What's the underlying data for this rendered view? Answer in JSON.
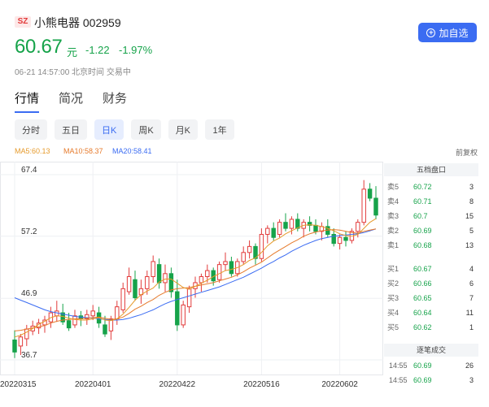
{
  "header": {
    "exchange": "SZ",
    "stock_name": "小熊电器 002959",
    "price": "60.67",
    "unit": "元",
    "change": "-1.22",
    "change_pct": "-1.97%",
    "time_status": "06-21 14:57:00 北京时间 交易中",
    "add_button": "加自选"
  },
  "tabs": [
    "行情",
    "简况",
    "财务"
  ],
  "periods": [
    "分时",
    "五日",
    "日K",
    "周K",
    "月K",
    "1年"
  ],
  "ma": {
    "ma5": "MA5:60.13",
    "ma10": "MA10:58.37",
    "ma20": "MA20:58.41",
    "adjust": "前复权"
  },
  "order_book": {
    "title": "五档盘口",
    "sell": [
      {
        "label": "卖5",
        "price": "60.72",
        "vol": "3"
      },
      {
        "label": "卖4",
        "price": "60.71",
        "vol": "8"
      },
      {
        "label": "卖3",
        "price": "60.7",
        "vol": "15"
      },
      {
        "label": "卖2",
        "price": "60.69",
        "vol": "5"
      },
      {
        "label": "卖1",
        "price": "60.68",
        "vol": "13"
      }
    ],
    "buy": [
      {
        "label": "买1",
        "price": "60.67",
        "vol": "4"
      },
      {
        "label": "买2",
        "price": "60.66",
        "vol": "6"
      },
      {
        "label": "买3",
        "price": "60.65",
        "vol": "7"
      },
      {
        "label": "买4",
        "price": "60.64",
        "vol": "11"
      },
      {
        "label": "买5",
        "price": "60.62",
        "vol": "1"
      }
    ],
    "trades_title": "逐笔成交",
    "trades": [
      {
        "time": "14:55",
        "price": "60.69",
        "vol": "26"
      },
      {
        "time": "14:55",
        "price": "60.69",
        "vol": "3"
      }
    ]
  },
  "colors": {
    "up": "#e23b3b",
    "down": "#16a34a",
    "accent": "#3b6cf2",
    "ma5": "#e69a2b",
    "ma10": "#e67a2b",
    "ma20": "#3b6cf2"
  },
  "chart_data": {
    "type": "candlestick",
    "y_ticks": [
      "67.4",
      "57.2",
      "46.9",
      "36.7"
    ],
    "ylim": [
      36.7,
      67.4
    ],
    "x_ticks": [
      {
        "label": "20220315",
        "index": 0
      },
      {
        "label": "20220401",
        "index": 13
      },
      {
        "label": "20220422",
        "index": 27
      },
      {
        "label": "20220516",
        "index": 41
      },
      {
        "label": "20220602",
        "index": 54
      }
    ],
    "candles": [
      {
        "o": 40.0,
        "h": 41.6,
        "l": 37.0,
        "c": 38.0
      },
      {
        "o": 39.0,
        "h": 41.0,
        "l": 37.5,
        "c": 40.5
      },
      {
        "o": 40.2,
        "h": 42.5,
        "l": 39.0,
        "c": 41.8
      },
      {
        "o": 41.5,
        "h": 43.2,
        "l": 40.8,
        "c": 42.3
      },
      {
        "o": 42.0,
        "h": 43.5,
        "l": 41.0,
        "c": 42.8
      },
      {
        "o": 42.5,
        "h": 44.0,
        "l": 41.2,
        "c": 43.3
      },
      {
        "o": 43.0,
        "h": 45.5,
        "l": 42.0,
        "c": 44.5
      },
      {
        "o": 44.0,
        "h": 46.5,
        "l": 43.0,
        "c": 44.8
      },
      {
        "o": 44.5,
        "h": 46.0,
        "l": 42.5,
        "c": 43.0
      },
      {
        "o": 43.2,
        "h": 44.5,
        "l": 41.5,
        "c": 42.0
      },
      {
        "o": 42.5,
        "h": 45.0,
        "l": 42.0,
        "c": 44.0
      },
      {
        "o": 44.0,
        "h": 44.8,
        "l": 42.3,
        "c": 43.5
      },
      {
        "o": 43.5,
        "h": 45.0,
        "l": 42.5,
        "c": 44.2
      },
      {
        "o": 44.0,
        "h": 45.8,
        "l": 43.3,
        "c": 44.8
      },
      {
        "o": 44.5,
        "h": 45.5,
        "l": 42.0,
        "c": 42.8
      },
      {
        "o": 42.5,
        "h": 44.0,
        "l": 40.5,
        "c": 41.0
      },
      {
        "o": 41.5,
        "h": 44.0,
        "l": 40.0,
        "c": 43.5
      },
      {
        "o": 43.5,
        "h": 46.5,
        "l": 42.5,
        "c": 45.5
      },
      {
        "o": 45.0,
        "h": 49.5,
        "l": 44.5,
        "c": 48.5
      },
      {
        "o": 48.0,
        "h": 52.0,
        "l": 47.5,
        "c": 50.5
      },
      {
        "o": 50.0,
        "h": 51.5,
        "l": 46.5,
        "c": 47.0
      },
      {
        "o": 47.5,
        "h": 50.0,
        "l": 46.0,
        "c": 48.5
      },
      {
        "o": 48.5,
        "h": 51.5,
        "l": 47.5,
        "c": 50.5
      },
      {
        "o": 50.5,
        "h": 54.0,
        "l": 49.5,
        "c": 53.0
      },
      {
        "o": 52.5,
        "h": 53.5,
        "l": 48.5,
        "c": 49.5
      },
      {
        "o": 49.5,
        "h": 52.5,
        "l": 48.0,
        "c": 51.0
      },
      {
        "o": 51.0,
        "h": 52.0,
        "l": 47.0,
        "c": 48.0
      },
      {
        "o": 48.0,
        "h": 50.0,
        "l": 41.5,
        "c": 42.5
      },
      {
        "o": 42.5,
        "h": 46.5,
        "l": 42.0,
        "c": 45.8
      },
      {
        "o": 45.5,
        "h": 49.0,
        "l": 44.5,
        "c": 48.5
      },
      {
        "o": 48.5,
        "h": 50.5,
        "l": 47.0,
        "c": 49.5
      },
      {
        "o": 49.5,
        "h": 51.0,
        "l": 48.0,
        "c": 50.5
      },
      {
        "o": 50.5,
        "h": 52.5,
        "l": 49.5,
        "c": 51.5
      },
      {
        "o": 51.5,
        "h": 52.0,
        "l": 49.0,
        "c": 49.8
      },
      {
        "o": 50.0,
        "h": 53.0,
        "l": 49.5,
        "c": 52.5
      },
      {
        "o": 52.5,
        "h": 54.5,
        "l": 51.5,
        "c": 53.0
      },
      {
        "o": 53.0,
        "h": 53.8,
        "l": 50.5,
        "c": 51.0
      },
      {
        "o": 51.0,
        "h": 53.5,
        "l": 50.5,
        "c": 53.0
      },
      {
        "o": 53.0,
        "h": 55.5,
        "l": 52.5,
        "c": 54.5
      },
      {
        "o": 54.5,
        "h": 56.5,
        "l": 53.5,
        "c": 55.5
      },
      {
        "o": 55.5,
        "h": 56.0,
        "l": 52.5,
        "c": 53.5
      },
      {
        "o": 53.5,
        "h": 58.5,
        "l": 53.0,
        "c": 57.5
      },
      {
        "o": 57.5,
        "h": 59.0,
        "l": 56.0,
        "c": 58.5
      },
      {
        "o": 58.5,
        "h": 59.5,
        "l": 56.5,
        "c": 57.0
      },
      {
        "o": 57.5,
        "h": 60.0,
        "l": 57.0,
        "c": 59.5
      },
      {
        "o": 59.5,
        "h": 61.0,
        "l": 58.0,
        "c": 58.5
      },
      {
        "o": 58.5,
        "h": 60.5,
        "l": 57.5,
        "c": 60.0
      },
      {
        "o": 60.0,
        "h": 61.0,
        "l": 58.0,
        "c": 58.5
      },
      {
        "o": 58.5,
        "h": 60.0,
        "l": 57.0,
        "c": 59.5
      },
      {
        "o": 59.5,
        "h": 60.5,
        "l": 58.0,
        "c": 59.0
      },
      {
        "o": 59.0,
        "h": 60.0,
        "l": 57.5,
        "c": 58.0
      },
      {
        "o": 58.0,
        "h": 59.5,
        "l": 56.5,
        "c": 58.8
      },
      {
        "o": 58.8,
        "h": 60.0,
        "l": 57.0,
        "c": 57.5
      },
      {
        "o": 57.5,
        "h": 58.5,
        "l": 55.5,
        "c": 56.0
      },
      {
        "o": 56.0,
        "h": 57.5,
        "l": 55.0,
        "c": 57.0
      },
      {
        "o": 57.0,
        "h": 58.0,
        "l": 55.5,
        "c": 56.5
      },
      {
        "o": 56.5,
        "h": 58.5,
        "l": 56.0,
        "c": 58.0
      },
      {
        "o": 58.0,
        "h": 60.0,
        "l": 57.0,
        "c": 59.5
      },
      {
        "o": 59.5,
        "h": 66.5,
        "l": 59.0,
        "c": 65.0
      },
      {
        "o": 65.0,
        "h": 66.0,
        "l": 63.0,
        "c": 63.5
      },
      {
        "o": 63.5,
        "h": 65.5,
        "l": 60.0,
        "c": 60.7
      }
    ],
    "ma5": [
      40.5,
      40.8,
      41.3,
      41.9,
      42.6,
      43.1,
      43.7,
      44.0,
      43.9,
      43.6,
      43.4,
      43.3,
      43.3,
      43.5,
      43.7,
      43.3,
      43.2,
      43.5,
      44.3,
      45.4,
      46.6,
      47.5,
      48.1,
      48.6,
      49.6,
      50.1,
      50.1,
      49.4,
      48.7,
      48.4,
      48.9,
      49.4,
      49.9,
      50.5,
      51.0,
      51.5,
      51.7,
      52.0,
      52.5,
      53.2,
      53.6,
      54.5,
      55.6,
      56.4,
      56.9,
      57.6,
      58.1,
      58.6,
      59.0,
      59.1,
      59.0,
      58.8,
      58.5,
      58.1,
      57.6,
      57.3,
      57.2,
      57.5,
      58.5,
      59.5,
      60.1
    ],
    "ma10": [
      41.5,
      41.6,
      41.8,
      42.0,
      42.2,
      42.4,
      42.8,
      43.1,
      43.3,
      43.4,
      43.5,
      43.5,
      43.6,
      43.7,
      43.8,
      43.6,
      43.4,
      43.5,
      43.8,
      44.4,
      45.1,
      45.6,
      46.2,
      46.7,
      47.4,
      47.9,
      48.3,
      48.5,
      48.6,
      48.7,
      48.9,
      49.1,
      49.3,
      49.5,
      49.8,
      50.1,
      50.4,
      50.8,
      51.3,
      51.9,
      52.4,
      52.9,
      53.6,
      54.3,
      54.9,
      55.5,
      56.1,
      56.6,
      57.2,
      57.6,
      57.9,
      58.1,
      58.2,
      58.3,
      58.2,
      58.0,
      57.8,
      57.7,
      58.0,
      58.2,
      58.4
    ],
    "ma20": [
      47.0,
      46.6,
      46.2,
      45.8,
      45.4,
      45.0,
      44.7,
      44.5,
      44.3,
      44.1,
      43.9,
      43.8,
      43.7,
      43.6,
      43.5,
      43.4,
      43.3,
      43.3,
      43.4,
      43.6,
      43.9,
      44.2,
      44.6,
      45.0,
      45.5,
      46.0,
      46.4,
      46.7,
      47.0,
      47.3,
      47.6,
      47.9,
      48.2,
      48.5,
      48.8,
      49.2,
      49.6,
      50.0,
      50.4,
      50.9,
      51.4,
      51.9,
      52.5,
      53.0,
      53.6,
      54.1,
      54.7,
      55.2,
      55.7,
      56.1,
      56.5,
      56.8,
      57.0,
      57.2,
      57.3,
      57.4,
      57.5,
      57.6,
      57.8,
      58.1,
      58.4
    ]
  }
}
